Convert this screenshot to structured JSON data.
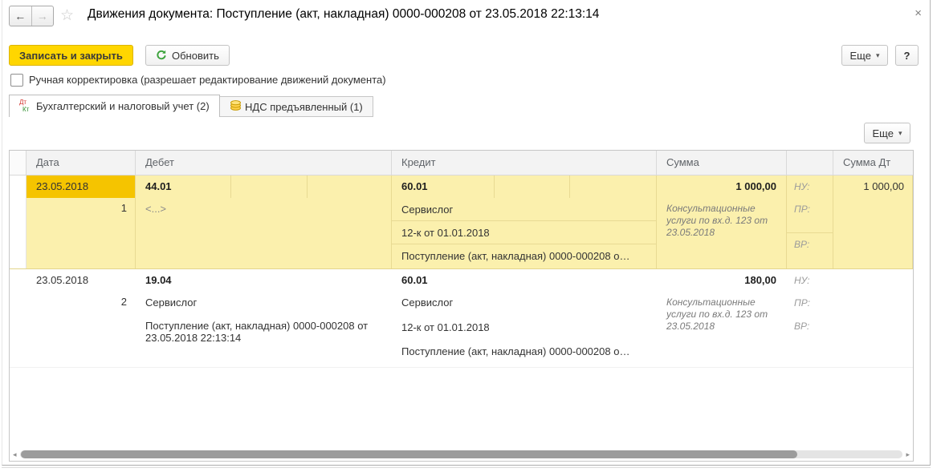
{
  "window": {
    "title": "Движения документа: Поступление (акт, накладная) 0000-000208 от 23.05.2018 22:13:14",
    "close_label": "×"
  },
  "nav": {
    "back": "←",
    "forward": "→",
    "favorite": "☆"
  },
  "toolbar": {
    "save_close": "Записать и закрыть",
    "refresh": "Обновить",
    "more": "Еще",
    "more_caret": "▾",
    "help": "?"
  },
  "manual_adjustment": {
    "checked": false,
    "label": "Ручная корректировка (разрешает редактирование движений документа)"
  },
  "tabs": [
    {
      "dt": "Дт",
      "kt": "Кт",
      "label": "Бухгалтерский и налоговый учет (2)",
      "active": true
    },
    {
      "label": "НДС предъявленный (1)",
      "active": false
    }
  ],
  "grid": {
    "more": "Еще",
    "more_caret": "▾",
    "headers": {
      "date": "Дата",
      "debit": "Дебет",
      "credit": "Кредит",
      "sum": "Сумма",
      "flags": "",
      "sum_dt": "Сумма Дт"
    },
    "flags": {
      "nu": "НУ:",
      "pr": "ПР:",
      "vr": "ВР:"
    },
    "rows": [
      {
        "date": "23.05.2018",
        "num": "1",
        "debit_account": "44.01",
        "debit_details": [
          "<...>"
        ],
        "credit_account": "60.01",
        "credit_details": [
          "Сервислог",
          "12-к от 01.01.2018",
          "Поступление (акт, накладная) 0000-000208 о…"
        ],
        "sum": "1 000,00",
        "comment": "Консультационные услуги по вх.д. 123 от 23.05.2018",
        "sum_dt": "1 000,00",
        "selected": true
      },
      {
        "date": "23.05.2018",
        "num": "2",
        "debit_account": "19.04",
        "debit_details": [
          "Сервислог",
          "Поступление (акт, накладная) 0000-000208 от 23.05.2018 22:13:14"
        ],
        "credit_account": "60.01",
        "credit_details": [
          "Сервислог",
          "12-к от 01.01.2018",
          "Поступление (акт, накладная) 0000-000208 о…"
        ],
        "sum": "180,00",
        "comment": "Консультационные услуги по вх.д. 123 от 23.05.2018",
        "sum_dt": "",
        "selected": false
      }
    ]
  },
  "scrollbar": {
    "left": "◂",
    "right": "▸"
  },
  "colors": {
    "accent_yellow": "#ffd600",
    "selected_cell": "#f5c400",
    "row_highlight": "#fbf0ad",
    "dt_red": "#d2322d",
    "kt_green": "#2f8f2f",
    "refresh_green": "#3da33d"
  }
}
